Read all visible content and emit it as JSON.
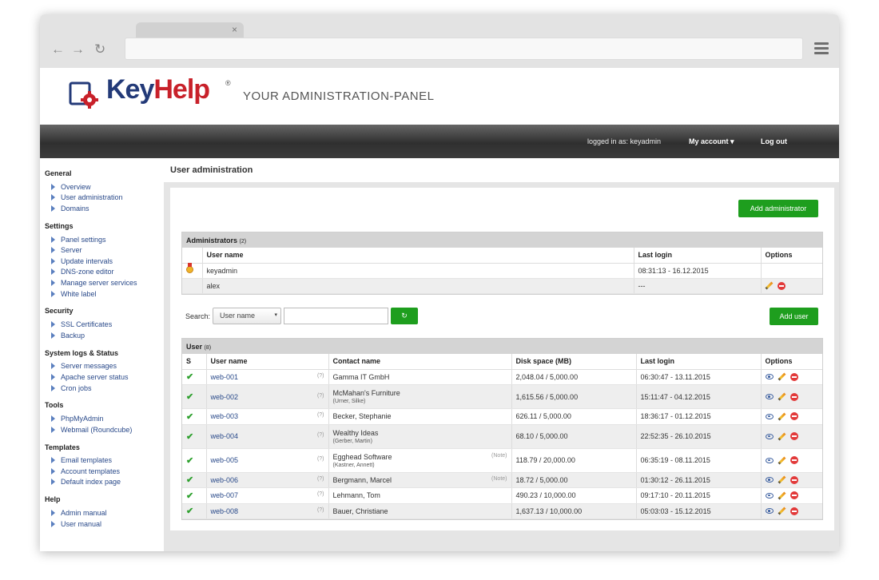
{
  "browser": {
    "tab_close": "×",
    "back_icon": "←",
    "forward_icon": "→",
    "reload_icon": "↻"
  },
  "header": {
    "logo_key": "Key",
    "logo_help": "Help",
    "logo_reg": "®",
    "slogan": "YOUR ADMINISTRATION-PANEL"
  },
  "topbar": {
    "logged_in": "logged in as: keyadmin",
    "my_account": "My account ▾",
    "logout": "Log out"
  },
  "sidebar": {
    "groups": [
      {
        "title": "General",
        "items": [
          "Overview",
          "User administration",
          "Domains"
        ]
      },
      {
        "title": "Settings",
        "items": [
          "Panel settings",
          "Server",
          "Update intervals",
          "DNS-zone editor",
          "Manage server services",
          "White label"
        ]
      },
      {
        "title": "Security",
        "items": [
          "SSL Certificates",
          "Backup"
        ]
      },
      {
        "title": "System logs & Status",
        "items": [
          "Server messages",
          "Apache server status",
          "Cron jobs"
        ]
      },
      {
        "title": "Tools",
        "items": [
          "PhpMyAdmin",
          "Webmail (Roundcube)"
        ]
      },
      {
        "title": "Templates",
        "items": [
          "Email templates",
          "Account templates",
          "Default index page"
        ]
      },
      {
        "title": "Help",
        "items": [
          "Admin manual",
          "User manual"
        ]
      }
    ]
  },
  "main": {
    "title": "User administration",
    "add_admin_label": "Add administrator",
    "add_user_label": "Add user",
    "admins": {
      "title": "Administrators",
      "count": "(2)",
      "columns": [
        "User name",
        "Last login",
        "Options"
      ],
      "rows": [
        {
          "name": "keyadmin",
          "last_login": "08:31:13 - 16.12.2015"
        },
        {
          "name": "alex",
          "last_login": "---"
        }
      ]
    },
    "search": {
      "label": "Search:",
      "field": "User name",
      "caret": "▾",
      "refresh": "↻"
    },
    "users": {
      "title": "User",
      "count": "(8)",
      "columns": [
        "S",
        "User name",
        "Contact name",
        "Disk space (MB)",
        "Last login",
        "Options"
      ],
      "help_mark": "(?)",
      "note_label": "(Note)",
      "check": "✔",
      "rows": [
        {
          "name": "web-001",
          "contact": "Gamma IT GmbH",
          "sub": "",
          "disk": "2,048.04 / 5,000.00",
          "login": "06:30:47 - 13.11.2015"
        },
        {
          "name": "web-002",
          "contact": "McMahan's Furniture",
          "sub": "(Urner, Silke)",
          "disk": "1,615.56 / 5,000.00",
          "login": "15:11:47 - 04.12.2015"
        },
        {
          "name": "web-003",
          "contact": "Becker, Stephanie",
          "sub": "",
          "disk": "626.11 / 5,000.00",
          "login": "18:36:17 - 01.12.2015"
        },
        {
          "name": "web-004",
          "contact": "Wealthy Ideas",
          "sub": "(Gerber, Martin)",
          "disk": "68.10 / 5,000.00",
          "login": "22:52:35 - 26.10.2015"
        },
        {
          "name": "web-005",
          "contact": "Egghead Software",
          "sub": "(Kastner, Annett)",
          "disk": "118.79 / 20,000.00",
          "login": "06:35:19 - 08.11.2015"
        },
        {
          "name": "web-006",
          "contact": "Bergmann, Marcel",
          "sub": "",
          "disk": "18.72 / 5,000.00",
          "login": "01:30:12 - 26.11.2015"
        },
        {
          "name": "web-007",
          "contact": "Lehmann, Tom",
          "sub": "",
          "disk": "490.23 / 10,000.00",
          "login": "09:17:10 - 20.11.2015"
        },
        {
          "name": "web-008",
          "contact": "Bauer, Christiane",
          "sub": "",
          "disk": "1,637.13 / 10,000.00",
          "login": "05:03:03 - 15.12.2015"
        }
      ]
    }
  }
}
